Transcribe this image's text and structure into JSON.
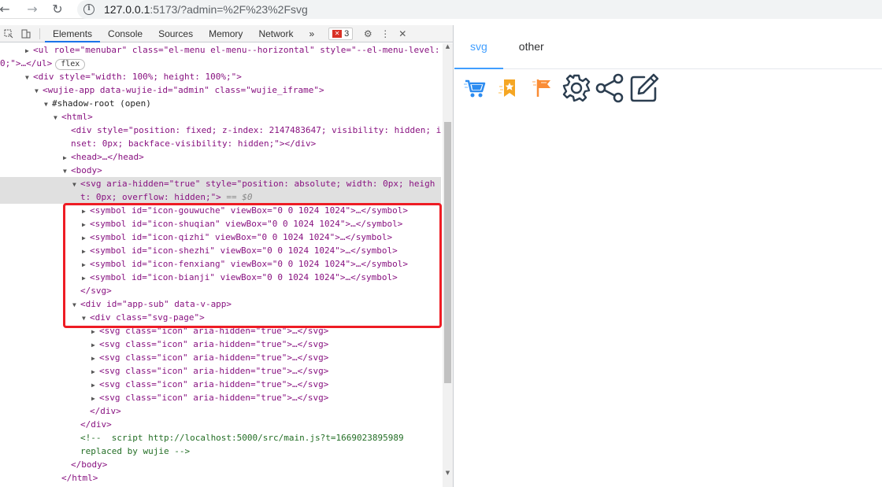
{
  "browser": {
    "url_host": "127.0.0.1",
    "url_rest": ":5173/?admin=%2F%23%2Fsvg"
  },
  "devtools": {
    "tabs": [
      "Elements",
      "Console",
      "Sources",
      "Memory",
      "Network"
    ],
    "more_tabs": "»",
    "error_count": "3",
    "lines": {
      "l1a": "<ul role=\"menubar\" class=\"el-menu el-menu--horizontal\" style=\"--el-menu-level:",
      "l1b": "0;\">…</ul>",
      "flex": "flex",
      "l2": "<div style=\"width: 100%; height: 100%;\">",
      "l3": "<wujie-app data-wujie-id=\"admin\" class=\"wujie_iframe\">",
      "l4": "#shadow-root (open)",
      "l5": "<html>",
      "l6a": "<div style=\"position: fixed; z-index: 2147483647; visibility: hidden; i",
      "l6b": "nset: 0px; backface-visibility: hidden;\"></div>",
      "l7": "<head>…</head>",
      "l8": "<body>",
      "l9a": "<svg aria-hidden=\"true\" style=\"position: absolute; width: 0px; heigh",
      "l9b": "t: 0px; overflow: hidden;\">",
      "l9c": " == $0",
      "sym1": "<symbol id=\"icon-gouwuche\" viewBox=\"0 0 1024 1024\">…</symbol>",
      "sym2": "<symbol id=\"icon-shuqian\" viewBox=\"0 0 1024 1024\">…</symbol>",
      "sym3": "<symbol id=\"icon-qizhi\" viewBox=\"0 0 1024 1024\">…</symbol>",
      "sym4": "<symbol id=\"icon-shezhi\" viewBox=\"0 0 1024 1024\">…</symbol>",
      "sym5": "<symbol id=\"icon-fenxiang\" viewBox=\"0 0 1024 1024\">…</symbol>",
      "sym6": "<symbol id=\"icon-bianji\" viewBox=\"0 0 1024 1024\">…</symbol>",
      "svgclose": "</svg>",
      "appsub": "<div id=\"app-sub\" data-v-app>",
      "svgpage": "<div class=\"svg-page\">",
      "svgicon": "<svg class=\"icon\" aria-hidden=\"true\">…</svg>",
      "divclose": "</div>",
      "cmt1": "<!--  script http://localhost:5000/src/main.js?t=1669023895989",
      "cmt2": "replaced by wujie -->",
      "bodyclose": "</body>",
      "htmlclose": "</html>"
    }
  },
  "app": {
    "menu": [
      "svg",
      "other"
    ],
    "icons": [
      "cart-icon",
      "bookmark-icon",
      "flag-icon",
      "gear-icon",
      "share-icon",
      "edit-icon"
    ],
    "colors": {
      "active": "#409eff",
      "cart": "#2d8cf0",
      "bookmark": "#f5a623",
      "flag": "#fa8c35",
      "line_icons": "#2c3e50"
    }
  }
}
